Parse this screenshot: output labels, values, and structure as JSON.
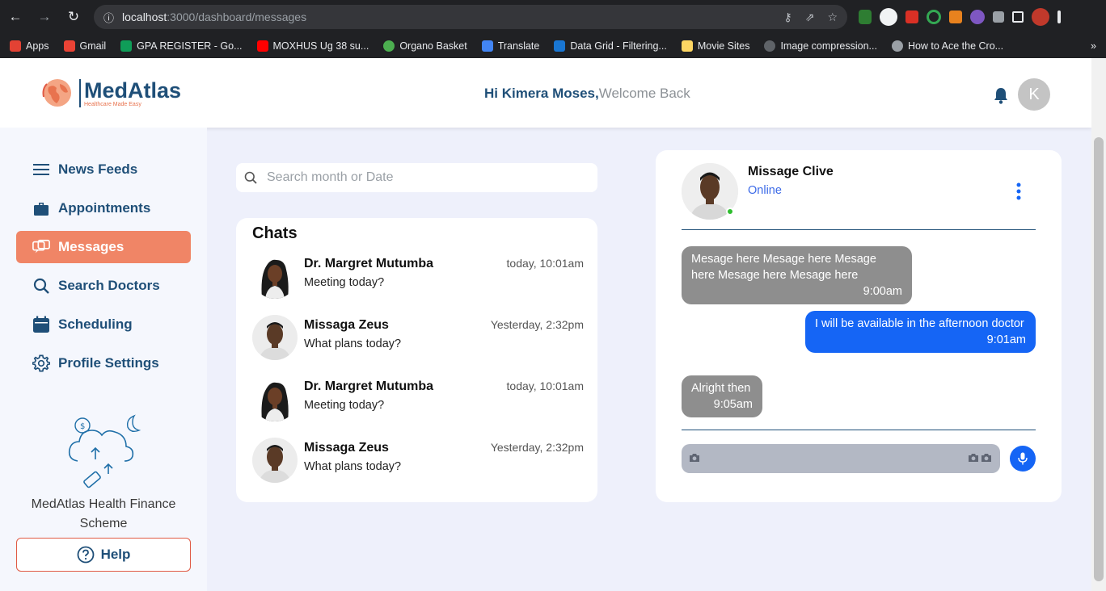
{
  "browser": {
    "url_host": "localhost",
    "url_path": ":3000/dashboard/messages",
    "bookmarks": [
      {
        "label": "Apps",
        "color": "#e34234"
      },
      {
        "label": "Gmail",
        "color": "#ea4335"
      },
      {
        "label": "GPA REGISTER - Go...",
        "color": "#0f9d58"
      },
      {
        "label": "MOXHUS Ug 38 su...",
        "color": "#ff0000"
      },
      {
        "label": "Organo Basket",
        "color": "#4caf50"
      },
      {
        "label": "Translate",
        "color": "#4285f4"
      },
      {
        "label": "Data Grid - Filtering...",
        "color": "#1976d2"
      },
      {
        "label": "Movie Sites",
        "color": "#fdd663"
      },
      {
        "label": "Image compression...",
        "color": "#5f6368"
      },
      {
        "label": "How to Ace the Cro...",
        "color": "#9aa0a6"
      }
    ]
  },
  "header": {
    "brand": "MedAtlas",
    "tagline": "Healthcare Made Easy",
    "greeting_name": "Hi Kimera Moses,",
    "greeting_rest": "Welcome Back",
    "avatar_initial": "K"
  },
  "sidebar": {
    "items": [
      {
        "label": "News Feeds",
        "icon": "menu-icon"
      },
      {
        "label": "Appointments",
        "icon": "briefcase-icon"
      },
      {
        "label": "Messages",
        "icon": "chat-icon",
        "active": true
      },
      {
        "label": "Search Doctors",
        "icon": "search-icon"
      },
      {
        "label": "Scheduling",
        "icon": "calendar-icon"
      },
      {
        "label": "Profile Settings",
        "icon": "gear-icon"
      }
    ],
    "finance_title": "MedAtlas Health Finance Scheme",
    "help_label": "Help"
  },
  "search": {
    "placeholder": "Search month or Date"
  },
  "chats": {
    "title": "Chats",
    "items": [
      {
        "name": "Dr. Margret Mutumba",
        "message": "Meeting today?",
        "time": "today, 10:01am"
      },
      {
        "name": "Missaga Zeus",
        "message": "What plans today?",
        "time": "Yesterday, 2:32pm"
      },
      {
        "name": "Dr. Margret Mutumba",
        "message": "Meeting today?",
        "time": "today, 10:01am"
      },
      {
        "name": "Missaga Zeus",
        "message": "What plans today?",
        "time": "Yesterday, 2:32pm"
      }
    ]
  },
  "conversation": {
    "contact": "Missage Clive",
    "status": "Online",
    "messages": [
      {
        "text": "Mesage here Mesage here Mesage here Mesage here Mesage here",
        "time": "9:00am",
        "direction": "in"
      },
      {
        "text": "I will be available in the afternoon doctor",
        "time": "9:01am",
        "direction": "out"
      },
      {
        "text": "Alright then",
        "time": "9:05am",
        "direction": "in"
      }
    ]
  },
  "colors": {
    "brand": "#1f4f78",
    "accent": "#f08566",
    "outgoing": "#1565f5",
    "incoming": "#8e8e8e"
  }
}
